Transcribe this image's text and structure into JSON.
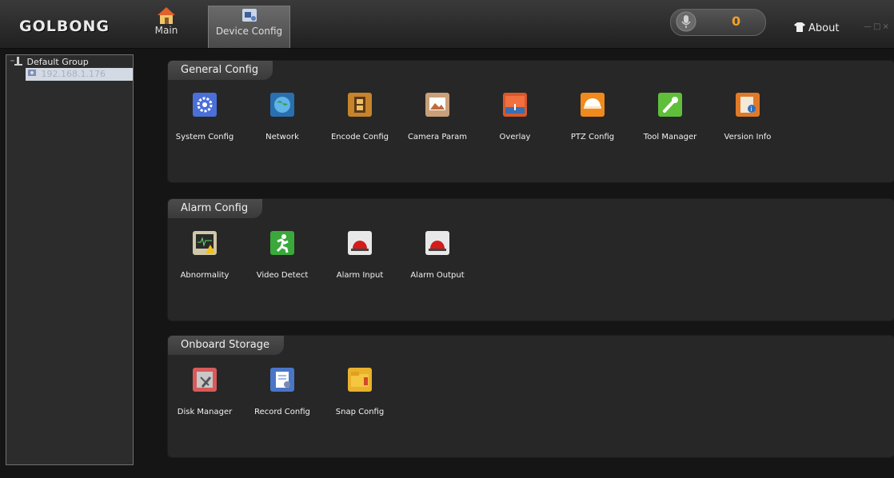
{
  "app": {
    "logo": "GOLBONG"
  },
  "nav": {
    "tabs": [
      {
        "label": "Main",
        "icon": "house-icon"
      },
      {
        "label": "Device Config",
        "icon": "device-config-icon"
      }
    ],
    "alarm_count": "0",
    "about_label": "About"
  },
  "tree": {
    "group_label": "Default Group",
    "device_label": "192.168.1.176"
  },
  "sections": [
    {
      "title": "General Config",
      "items": [
        {
          "label": "System Config",
          "icon": "gear-icon",
          "color": "#4a6fd8"
        },
        {
          "label": "Network",
          "icon": "globe-icon",
          "color": "#2a6fb0"
        },
        {
          "label": "Encode Config",
          "icon": "film-icon",
          "color": "#c8842a"
        },
        {
          "label": "Camera Param",
          "icon": "picture-icon",
          "color": "#c9a07a"
        },
        {
          "label": "Overlay",
          "icon": "overlay-icon",
          "color": "#d9582c"
        },
        {
          "label": "PTZ Config",
          "icon": "dome-camera-icon",
          "color": "#f08a1c"
        },
        {
          "label": "Tool Manager",
          "icon": "wrench-icon",
          "color": "#5fbf3a"
        },
        {
          "label": "Version Info",
          "icon": "info-icon",
          "color": "#e07a28"
        }
      ]
    },
    {
      "title": "Alarm Config",
      "items": [
        {
          "label": "Abnormality",
          "icon": "warning-monitor-icon",
          "color": "#cfc7a8"
        },
        {
          "label": "Video Detect",
          "icon": "running-man-icon",
          "color": "#3aa83a"
        },
        {
          "label": "Alarm Input",
          "icon": "alarm-light-icon",
          "color": "#d41c1c"
        },
        {
          "label": "Alarm Output",
          "icon": "alarm-light-icon",
          "color": "#d41c1c"
        }
      ]
    },
    {
      "title": "Onboard Storage",
      "items": [
        {
          "label": "Disk Manager",
          "icon": "disk-tool-icon",
          "color": "#d85a5a"
        },
        {
          "label": "Record Config",
          "icon": "record-doc-icon",
          "color": "#4a76c8"
        },
        {
          "label": "Snap Config",
          "icon": "folder-icon",
          "color": "#eab12c"
        }
      ]
    }
  ]
}
